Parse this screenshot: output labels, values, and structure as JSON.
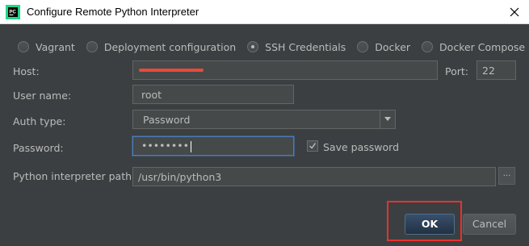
{
  "window": {
    "title": "Configure Remote Python Interpreter"
  },
  "credential_types": [
    {
      "label": "Vagrant",
      "checked": false
    },
    {
      "label": "Deployment configuration",
      "checked": false
    },
    {
      "label": "SSH Credentials",
      "checked": true
    },
    {
      "label": "Docker",
      "checked": false
    },
    {
      "label": "Docker Compose",
      "checked": false
    }
  ],
  "form": {
    "host_label": "Host:",
    "host_value": "",
    "port_label": "Port:",
    "port_value": "22",
    "username_label": "User name:",
    "username_value": "root",
    "auth_type_label": "Auth type:",
    "auth_type_value": "Password",
    "password_label": "Password:",
    "password_value": "••••••••",
    "save_password_label": "Save password",
    "save_password_checked": true,
    "interpreter_path_label": "Python interpreter path:",
    "interpreter_path_value": "/usr/bin/python3",
    "browse_label": "..."
  },
  "buttons": {
    "ok_label": "OK",
    "cancel_label": "Cancel"
  },
  "colors": {
    "dialog_bg": "#3c3f41",
    "field_bg": "#45494a",
    "focus_border": "#4e79b4",
    "redaction": "#e84a3b",
    "annotation_box": "#e8312f"
  }
}
